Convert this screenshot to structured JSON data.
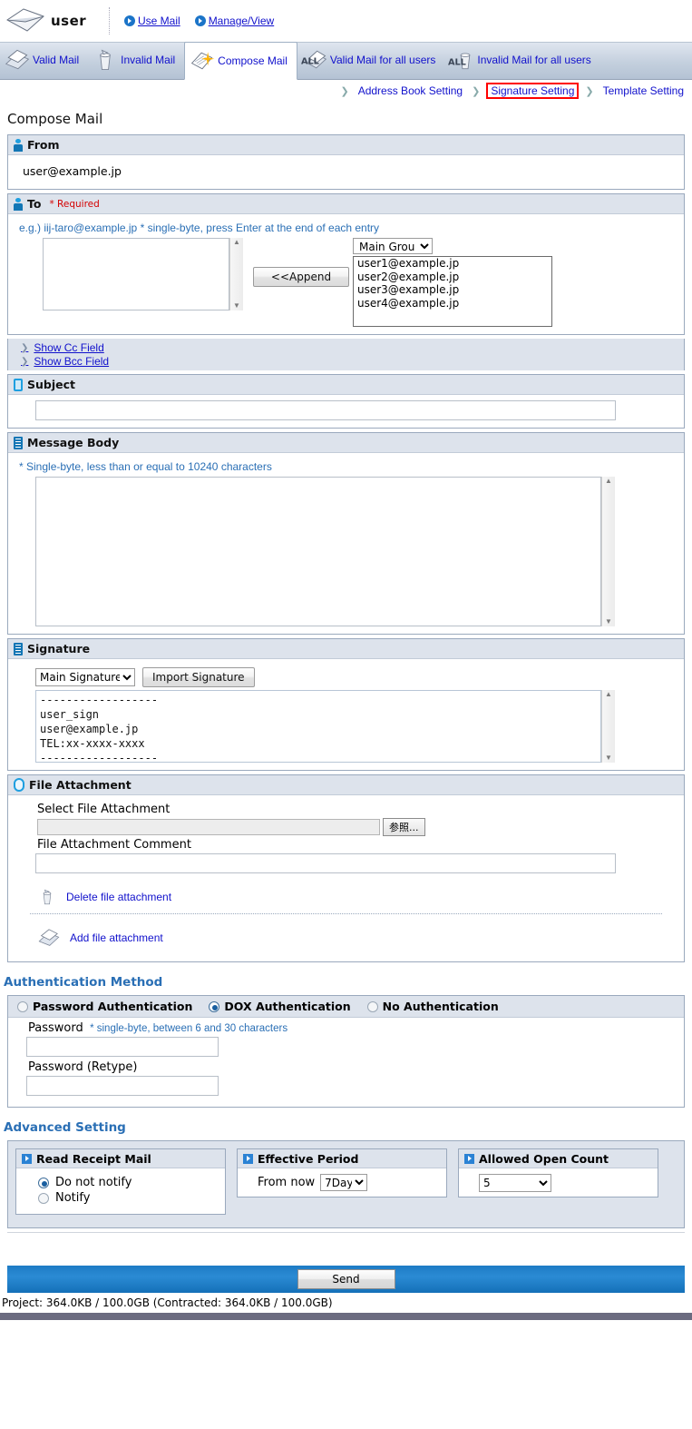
{
  "header": {
    "logo_icon": "envelope-icon",
    "user_name": "user",
    "links": [
      {
        "label": "Use Mail",
        "icon": "arrow-circle-icon"
      },
      {
        "label": "Manage/View",
        "icon": "arrow-circle-icon"
      }
    ]
  },
  "tabs": [
    {
      "label": "Valid Mail",
      "icon": "envelope-tray-icon",
      "active": false
    },
    {
      "label": "Invalid Mail",
      "icon": "trash-can-icon",
      "active": false
    },
    {
      "label": "Compose Mail",
      "icon": "compose-sparkle-icon",
      "active": true
    },
    {
      "label": "Valid Mail for all users",
      "icon": "all-envelope-icon",
      "active": false
    },
    {
      "label": "Invalid Mail for all users",
      "icon": "all-trash-icon",
      "active": false
    }
  ],
  "subnav": [
    {
      "label": "Address Book Setting",
      "highlighted": false
    },
    {
      "label": "Signature Setting",
      "highlighted": true
    },
    {
      "label": "Template Setting",
      "highlighted": false
    }
  ],
  "page_title": "Compose Mail",
  "from": {
    "heading": "From",
    "icon": "person-icon",
    "value": "user@example.jp"
  },
  "to": {
    "heading": "To",
    "required_label": "* Required",
    "icon": "person-icon",
    "hint": "e.g.) iij-taro@example.jp * single-byte, press Enter at the end of each entry",
    "textarea_value": "",
    "append_label": "<<Append",
    "group_select": {
      "value": "Main Group",
      "options": [
        "Main Group"
      ]
    },
    "address_list": [
      "user1@example.jp",
      "user2@example.jp",
      "user3@example.jp",
      "user4@example.jp"
    ]
  },
  "show_fields": [
    {
      "label": "Show Cc Field"
    },
    {
      "label": "Show Bcc Field"
    }
  ],
  "subject": {
    "heading": "Subject",
    "icon": "subject-icon",
    "value": ""
  },
  "message_body": {
    "heading": "Message Body",
    "icon": "lines-icon",
    "hint": "* Single-byte, less than or equal to 10240 characters",
    "value": ""
  },
  "signature": {
    "heading": "Signature",
    "icon": "lines-icon",
    "select": {
      "value": "Main Signature",
      "options": [
        "Main Signature"
      ]
    },
    "import_label": "Import Signature",
    "value": "------------------\nuser_sign\nuser@example.jp\nTEL:xx-xxxx-xxxx\n------------------"
  },
  "file_attachment": {
    "heading": "File Attachment",
    "icon": "paperclip-icon",
    "select_label": "Select File Attachment",
    "file_value": "",
    "browse_label": "参照...",
    "comment_label": "File Attachment Comment",
    "comment_value": "",
    "delete_label": "Delete file attachment",
    "delete_icon": "trash-can-icon",
    "add_label": "Add file attachment",
    "add_icon": "envelope-tray-icon"
  },
  "authentication": {
    "title": "Authentication Method",
    "options": [
      {
        "label": "Password Authentication",
        "selected": false
      },
      {
        "label": "DOX Authentication",
        "selected": true
      },
      {
        "label": "No Authentication",
        "selected": false
      }
    ],
    "password_label": "Password",
    "password_hint": "* single-byte, between 6 and 30 characters",
    "password_value": "",
    "password_retype_label": "Password (Retype)",
    "password_retype_value": ""
  },
  "advanced": {
    "title": "Advanced Setting",
    "read_receipt": {
      "heading": "Read Receipt Mail",
      "options": [
        {
          "label": "Do not notify",
          "selected": true
        },
        {
          "label": "Notify",
          "selected": false
        }
      ]
    },
    "effective_period": {
      "heading": "Effective Period",
      "prefix": "From now",
      "select": {
        "value": "7Day",
        "options": [
          "7Day"
        ]
      }
    },
    "allowed_open_count": {
      "heading": "Allowed Open Count",
      "select": {
        "value": "5",
        "options": [
          "5"
        ]
      }
    }
  },
  "footer": {
    "send_label": "Send",
    "quota": "Project: 364.0KB / 100.0GB (Contracted: 364.0KB / 100.0GB)"
  },
  "colors": {
    "accent_blue": "#2a6fb5",
    "link_blue": "#1111cc",
    "panel_head": "#dde3ec",
    "highlight_red": "#ff0000",
    "send_bar": "#1d7bc4"
  }
}
